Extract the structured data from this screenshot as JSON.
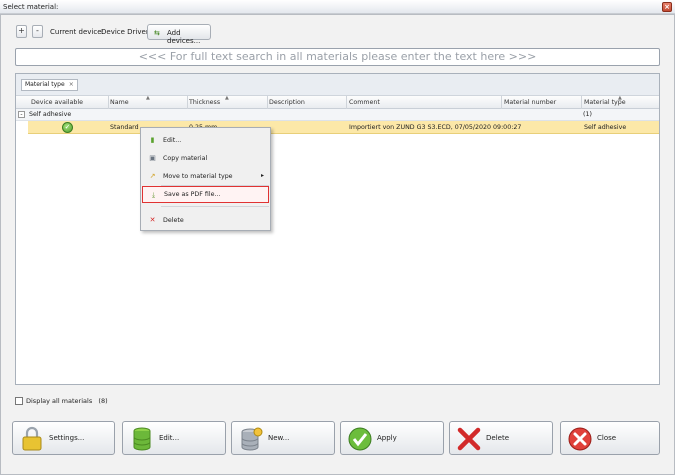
{
  "window": {
    "title": "Select material:",
    "close_glyph": "×"
  },
  "toolbar": {
    "plus": "+",
    "minus": "-",
    "current_device_label": "Current device:",
    "current_device_value": "Device Driver",
    "add_devices_label": "Add devices...",
    "add_devices_icon": "⇆"
  },
  "search": {
    "placeholder": "<<< For full text search in all materials please enter the text here >>>"
  },
  "grid": {
    "group_chip": "Material type",
    "group_chip_close": "×",
    "columns": [
      "Device available",
      "Name",
      "Thickness",
      "Description",
      "Comment",
      "Material number",
      "Material type"
    ],
    "group": {
      "toggle": "-",
      "label": "Self adhesive",
      "count": "(1)"
    },
    "row": {
      "available_icon": "check-circle",
      "check_glyph": "✓",
      "name": "Standard",
      "thickness": "0.25 mm",
      "description": "",
      "comment": "Importiert von ZUND G3 S3.ECD, 07/05/2020 09:00:27",
      "material_number": "",
      "material_type": "Self adhesive"
    }
  },
  "context_menu": {
    "items": [
      {
        "label": "Edit...",
        "icon": "edit-icon",
        "glyph": "▮"
      },
      {
        "label": "Copy material",
        "icon": "copy-icon",
        "glyph": "▣"
      },
      {
        "label": "Move to material type",
        "icon": "move-icon",
        "glyph": "↗",
        "submenu": "▸"
      },
      {
        "label": "Save as PDF file...",
        "icon": "pdf-icon",
        "glyph": "⤓"
      },
      {
        "label": "Delete",
        "icon": "delete-icon",
        "glyph": "✕"
      }
    ]
  },
  "footer": {
    "display_all_label": "Display all materials",
    "display_all_count": "(8)"
  },
  "buttons": {
    "settings": "Settings...",
    "edit": "Edit...",
    "new": "New...",
    "apply": "Apply",
    "delete": "Delete",
    "close": "Close"
  },
  "colors": {
    "selected_row": "#fce8a8",
    "highlight_border": "#e03232"
  }
}
